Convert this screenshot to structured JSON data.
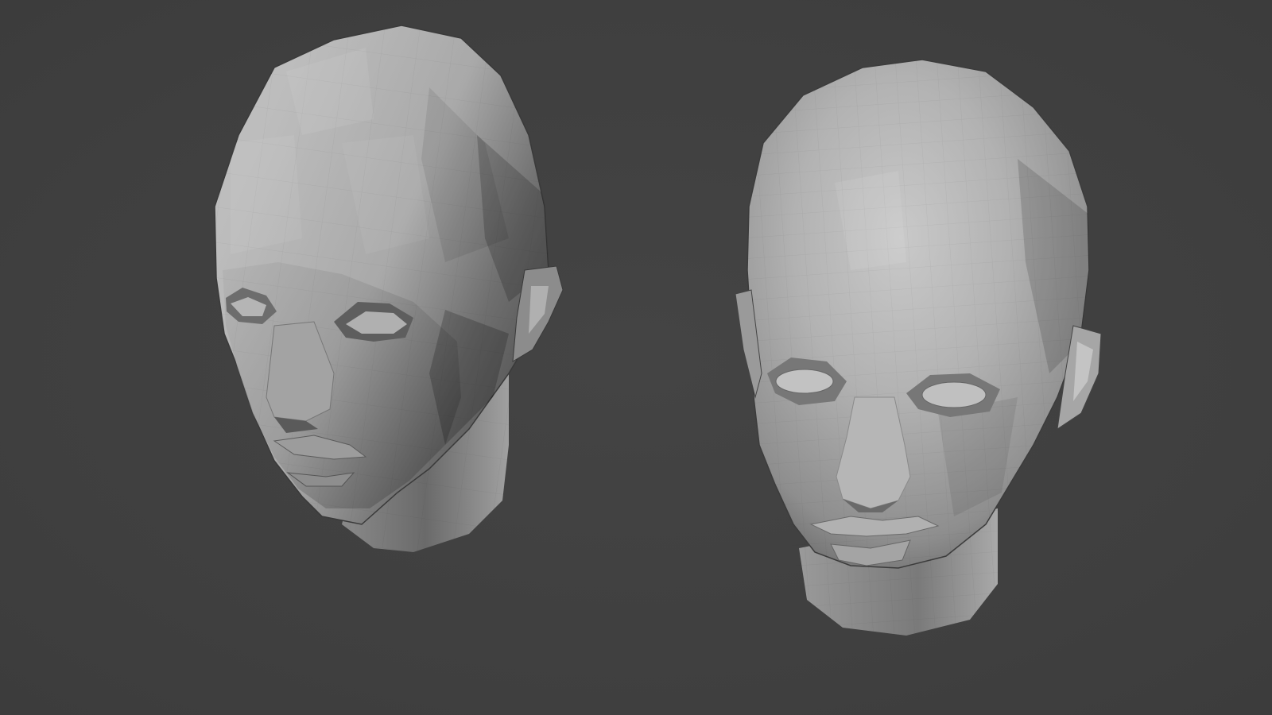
{
  "viewport": {
    "background_color": "#414141",
    "mesh_color": "#b8b8b8",
    "shadow_color": "#4a4a4a"
  },
  "models": [
    {
      "name": "low-poly-head",
      "shading": "flat",
      "detail": "low"
    },
    {
      "name": "subdivided-head",
      "shading": "flat",
      "detail": "medium"
    }
  ]
}
